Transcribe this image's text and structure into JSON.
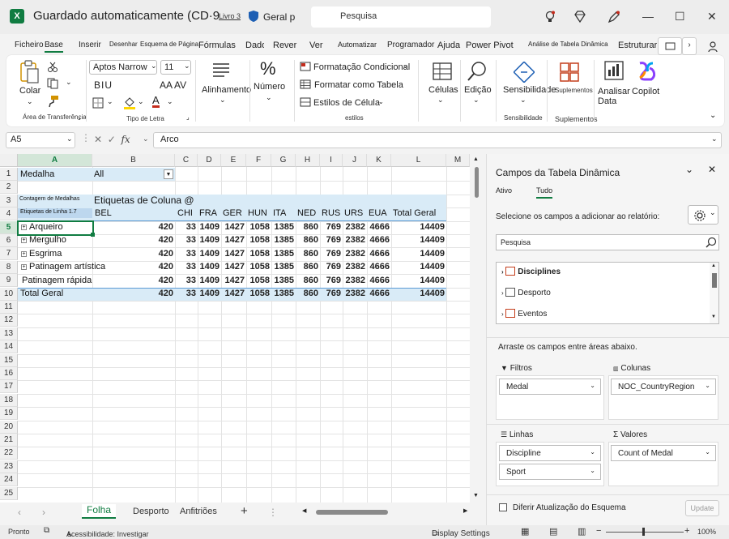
{
  "title_bar": {
    "app_logo": "X",
    "title": "Guardado automaticamente (CD·9",
    "book": "Livro 3",
    "sensitivity": "Geral p",
    "search_placeholder": "Pesquisa"
  },
  "ribbon_tabs": [
    "Ficheiro",
    "Base",
    "Inserir",
    "Desenhar",
    "Esquema de Página",
    "Fórmulas",
    "Dados",
    "Rever",
    "Ver",
    "Automatizar",
    "Programador",
    "Ajuda",
    "Power Pivot",
    "Análise de Tabela Dinâmica",
    "Estruturar"
  ],
  "ribbon_tab_active": "Base",
  "ribbon": {
    "clipboard": {
      "paste": "Colar",
      "group": "Área de Transferência"
    },
    "font": {
      "name": "Aptos Narrow",
      "size": "11",
      "bold_italic_underline": "BIU",
      "grow_shrink": "AA AV",
      "group": "Tipo de Letra"
    },
    "alignment": "Alinhamento",
    "number": "Número",
    "styles": {
      "conditional": "Formatação Condicional",
      "as_table": "Formatar como Tabela",
      "cell_styles": "Estilos de Célula",
      "group": "estilos"
    },
    "cells": "Células",
    "edit": "Edição",
    "sensitivity": "Sensibilidade",
    "sensitivity_group": "Sensibilidade",
    "addins": "Suplementos",
    "addins_group": "Suplementos",
    "analyze": "Analisar Data",
    "copilot": "Copilot"
  },
  "formula_bar": {
    "name_box": "A5",
    "fx": "fx",
    "formula": "Arco"
  },
  "grid": {
    "columns": [
      "A",
      "B",
      "C",
      "D",
      "E",
      "F",
      "G",
      "H",
      "I",
      "J",
      "K",
      "L",
      "M"
    ],
    "rows": [
      "1",
      "2",
      "3",
      "4",
      "5",
      "6",
      "7",
      "8",
      "9",
      "10",
      "11",
      "12",
      "13",
      "14",
      "15",
      "16",
      "17",
      "18",
      "19",
      "20",
      "21",
      "22",
      "23",
      "24",
      "25"
    ],
    "selected_column": "A",
    "selected_row": "5",
    "filter_label": "Medalha",
    "filter_value": "All",
    "count_label": "Contagem de Medalhas",
    "col_labels": "Etiquetas de Coluna @",
    "row_labels": "Etiquetas de Linha 1.7",
    "countries": [
      "BEL",
      "CHI",
      "FRA",
      "GER",
      "HUN",
      "ITA",
      "NED",
      "RUS",
      "URS",
      "EUA"
    ],
    "total_header": "Total Geral",
    "data_rows": [
      {
        "label": "Arqueiro",
        "exp": "+",
        "values": [
          "420",
          "33",
          "1409",
          "1427",
          "1058",
          "1385",
          "860",
          "769",
          "2382",
          "4666"
        ],
        "total": "14409"
      },
      {
        "label": "Mergulho",
        "exp": "+",
        "values": [
          "420",
          "33",
          "1409",
          "1427",
          "1058",
          "1385",
          "860",
          "769",
          "2382",
          "4666"
        ],
        "total": "14409"
      },
      {
        "label": "Esgrima",
        "exp": "+",
        "values": [
          "420",
          "33",
          "1409",
          "1427",
          "1058",
          "1385",
          "860",
          "769",
          "2382",
          "4666"
        ],
        "total": "14409"
      },
      {
        "label": "Patinagem artística",
        "exp": "+",
        "values": [
          "420",
          "33",
          "1409",
          "1427",
          "1058",
          "1385",
          "860",
          "769",
          "2382",
          "4666"
        ],
        "total": "14409"
      },
      {
        "label": "Patinagem rápida",
        "exp": "",
        "values": [
          "420",
          "33",
          "1409",
          "1427",
          "1058",
          "1385",
          "860",
          "769",
          "2382",
          "4666"
        ],
        "total": "14409"
      }
    ],
    "grand_total": {
      "label": "Total Geral",
      "values": [
        "420",
        "33",
        "1409",
        "1427",
        "1058",
        "1385",
        "860",
        "769",
        "2382",
        "4666"
      ],
      "total": "14409"
    }
  },
  "sheet_tabs": [
    "Folha",
    "Desporto",
    "Anfitriões"
  ],
  "sheet_tab_active": "Folha",
  "status_bar": {
    "ready": "Pronto",
    "accessibility": "Acessibilidade: Investigar",
    "display": "Display Settings",
    "zoom": "100%"
  },
  "pivot_pane": {
    "title": "Campos da Tabela Dinâmica",
    "tab_active": "Ativo",
    "tab_all": "Tudo",
    "select_label": "Selecione os campos a adicionar ao relatório:",
    "search_placeholder": "Pesquisa",
    "fields": [
      "Disciplines",
      "Desporto",
      "Eventos"
    ],
    "drag_label": "Arraste os campos entre áreas abaixo.",
    "filters_title": "Filtros",
    "columns_title": "Colunas",
    "rows_title": "Linhas",
    "values_title": "Valores",
    "filters_items": [
      "Medal"
    ],
    "columns_items": [
      "NOC_CountryRegion"
    ],
    "rows_items": [
      "Discipline",
      "Sport"
    ],
    "values_items": [
      "Count of Medal"
    ],
    "defer_label": "Diferir Atualização do Esquema",
    "update_button": "Update"
  }
}
